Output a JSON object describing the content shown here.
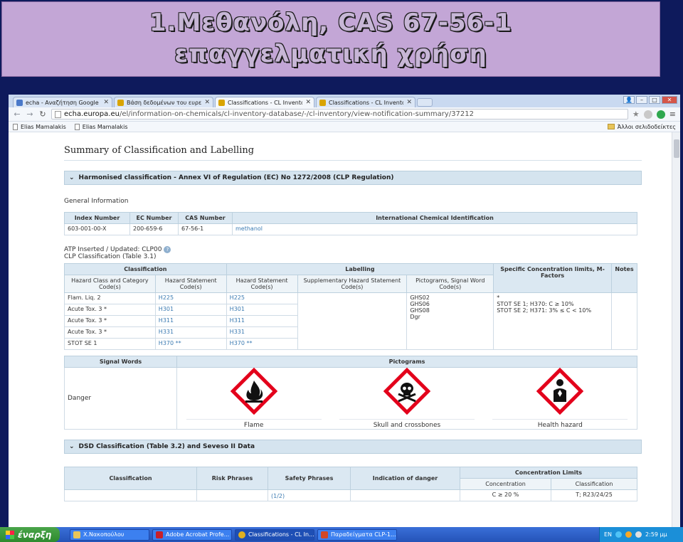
{
  "slide": {
    "title_line1": "1.Μεθανόλη, CAS 67-56-1",
    "title_line2": "επαγγελματική χρήση"
  },
  "browser": {
    "tabs": [
      {
        "label": "echa - Αναζήτηση Google",
        "icon_color": "#4a79c9"
      },
      {
        "label": "Βάση δεδομένων του ευρετη",
        "icon_color": "#d9a400"
      },
      {
        "label": "Classifications - CL Inventory",
        "icon_color": "#d9a400",
        "active": true
      },
      {
        "label": "Classifications - CL Inventory",
        "icon_color": "#d9a400"
      }
    ],
    "url_host": "echa.europa.eu",
    "url_path": "/el/information-on-chemicals/cl-inventory-database/-/cl-inventory/view-notification-summary/37212",
    "bookmarks": [
      "Elias Mamalakis",
      "Elias Mamalakis"
    ],
    "other_bookmarks": "Άλλοι σελιδοδείκτες"
  },
  "page": {
    "title": "Summary of Classification and Labelling",
    "harmonised_section": "Harmonised classification - Annex VI of Regulation (EC) No 1272/2008 (CLP Regulation)",
    "general_info": "General Information",
    "id_table": {
      "headers": [
        "Index Number",
        "EC Number",
        "CAS Number",
        "International Chemical Identification"
      ],
      "row": [
        "603-001-00-X",
        "200-659-6",
        "67-56-1",
        "methanol"
      ]
    },
    "atp": "ATP Inserted / Updated: CLP00",
    "clp_table_label": "CLP Classification (Table 3.1)",
    "clp_table": {
      "group_classification": "Classification",
      "group_labelling": "Labelling",
      "group_scl": "Specific Concentration limits, M-Factors",
      "group_notes": "Notes",
      "sub_headers": [
        "Hazard Class and Category Code(s)",
        "Hazard Statement Code(s)",
        "Hazard Statement Code(s)",
        "Supplementary Hazard Statement Code(s)",
        "Pictograms, Signal Word Code(s)"
      ],
      "rows": [
        {
          "cls": "Flam. Liq. 2",
          "hs": "H225",
          "lhs": "H225"
        },
        {
          "cls": "Acute Tox. 3 *",
          "hs": "H301",
          "lhs": "H301"
        },
        {
          "cls": "Acute Tox. 3 *",
          "hs": "H311",
          "lhs": "H311"
        },
        {
          "cls": "Acute Tox. 3 *",
          "hs": "H331",
          "lhs": "H331"
        },
        {
          "cls": "STOT SE 1",
          "hs": "H370 **",
          "lhs": "H370 **"
        }
      ],
      "pictogram_codes": [
        "GHS02",
        "GHS06",
        "GHS08",
        "Dgr"
      ],
      "scl_lines": [
        "*",
        "STOT SE 1; H370: C ≥ 10%",
        "STOT SE 2; H371: 3% ≤ C < 10%"
      ]
    },
    "signal_table": {
      "headers": [
        "Signal Words",
        "Pictograms"
      ],
      "signal_word": "Danger",
      "pictograms": [
        "Flame",
        "Skull and crossbones",
        "Health hazard"
      ]
    },
    "dsd_section": "DSD Classification (Table 3.2) and Seveso II Data",
    "dsd_table": {
      "headers": [
        "Classification",
        "Risk Phrases",
        "Safety Phrases",
        "Indication of danger",
        "Concentration Limits"
      ],
      "sub_headers": [
        "Concentration",
        "Classification"
      ],
      "row": {
        "safety": "(1/2)",
        "concentration": "C ≥ 20 %",
        "classification": "T; R23/24/25"
      }
    }
  },
  "taskbar": {
    "start": "έναρξη",
    "tasks": [
      "X.Νακοπούλου",
      "Adobe Acrobat Profe...",
      "Classifications - CL In...",
      "Παραδείγματα CLP-1..."
    ],
    "lang": "EN",
    "time": "2:59 μμ"
  },
  "colors": {
    "background": "#0e1a5c",
    "banner": "#c3a6d6",
    "section_header": "#d5e4ef",
    "link": "#3c7bb2",
    "pictogram_red": "#e3001b"
  }
}
